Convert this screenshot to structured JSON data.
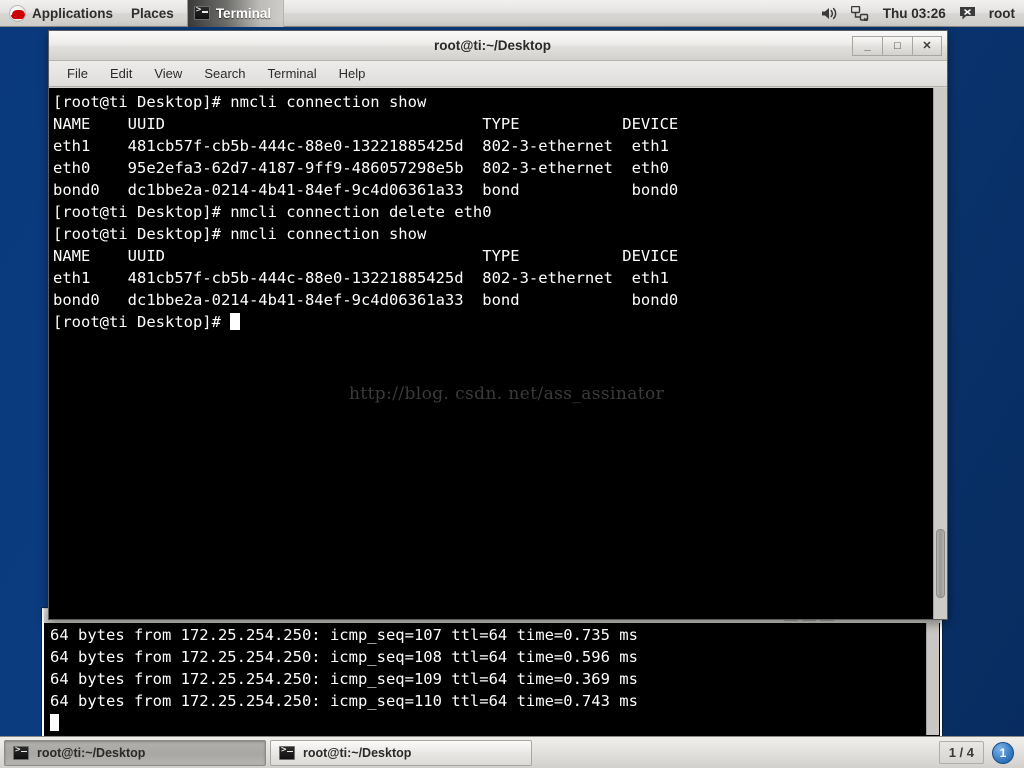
{
  "panel": {
    "applications_label": "Applications",
    "places_label": "Places",
    "window_task_label": "Terminal",
    "clock": "Thu 03:26",
    "user": "root",
    "icons": {
      "logo": "redhat-logo-icon",
      "volume": "volume-icon",
      "network": "network-disconnected-icon",
      "messaging": "messaging-icon"
    }
  },
  "front_window": {
    "title": "root@ti:~/Desktop",
    "menus": [
      "File",
      "Edit",
      "View",
      "Search",
      "Terminal",
      "Help"
    ],
    "controls": {
      "minimize": "_",
      "maximize": "□",
      "close": "✕"
    },
    "terminal_lines": [
      "[root@ti Desktop]# nmcli connection show",
      "NAME    UUID                                  TYPE           DEVICE",
      "eth1    481cb57f-cb5b-444c-88e0-13221885425d  802-3-ethernet  eth1",
      "eth0    95e2efa3-62d7-4187-9ff9-486057298e5b  802-3-ethernet  eth0",
      "bond0   dc1bbe2a-0214-4b41-84ef-9c4d06361a33  bond            bond0",
      "[root@ti Desktop]# nmcli connection delete eth0",
      "[root@ti Desktop]# nmcli connection show",
      "NAME    UUID                                  TYPE           DEVICE",
      "eth1    481cb57f-cb5b-444c-88e0-13221885425d  802-3-ethernet  eth1",
      "bond0   dc1bbe2a-0214-4b41-84ef-9c4d06361a33  bond            bond0"
    ],
    "prompt": "[root@ti Desktop]# ",
    "watermark": "http://blog. csdn. net/ass_assinator"
  },
  "back_window": {
    "terminal_lines": [
      "64 bytes from 172.25.254.250: icmp_seq=107 ttl=64 time=0.735 ms",
      "64 bytes from 172.25.254.250: icmp_seq=108 ttl=64 time=0.596 ms",
      "64 bytes from 172.25.254.250: icmp_seq=109 ttl=64 time=0.369 ms",
      "64 bytes from 172.25.254.250: icmp_seq=110 ttl=64 time=0.743 ms"
    ]
  },
  "taskbar": {
    "tasks": [
      {
        "label": "root@ti:~/Desktop",
        "active": true
      },
      {
        "label": "root@ti:~/Desktop",
        "active": false
      }
    ],
    "workspace": "1 / 4",
    "trash_count": "1"
  },
  "colors": {
    "desktop": "#0a3a7d",
    "terminal_bg": "#000000",
    "terminal_fg": "#ffffff",
    "panel_bg": "#e4e2e0",
    "accent": "#3b7fc4"
  }
}
